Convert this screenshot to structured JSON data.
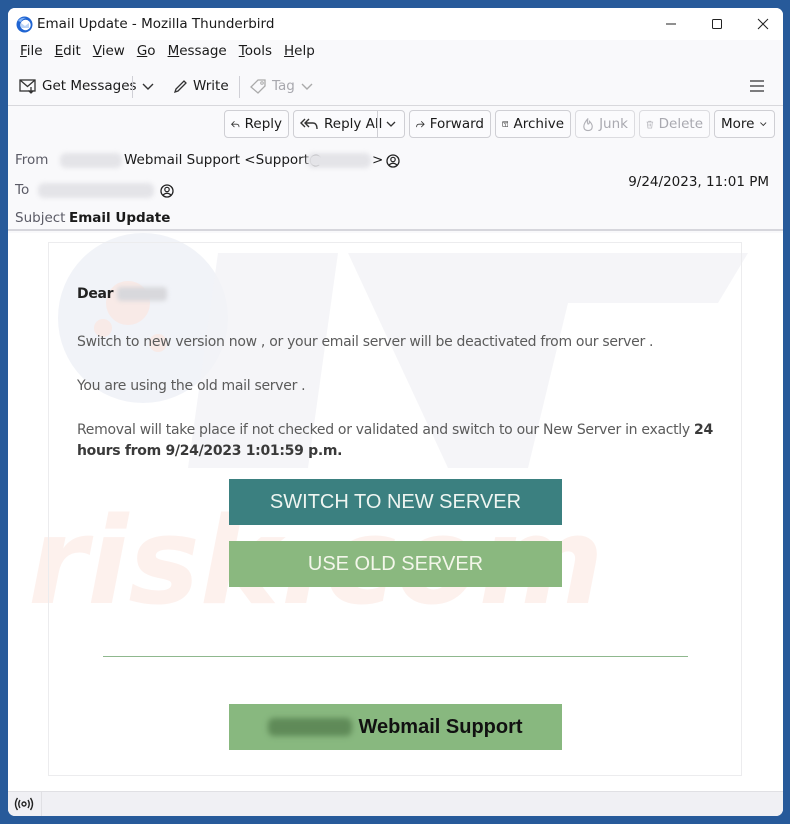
{
  "window": {
    "title": "Email Update - Mozilla Thunderbird",
    "controls": {
      "minimize": "minimize",
      "maximize": "maximize",
      "close": "close"
    }
  },
  "menubar": {
    "items": [
      {
        "label": "File",
        "accel": "F",
        "rest": "ile"
      },
      {
        "label": "Edit",
        "accel": "E",
        "rest": "dit"
      },
      {
        "label": "View",
        "accel": "V",
        "rest": "iew"
      },
      {
        "label": "Go",
        "accel": "G",
        "rest": "o"
      },
      {
        "label": "Message",
        "accel": "M",
        "rest": "essage"
      },
      {
        "label": "Tools",
        "accel": "T",
        "rest": "ools"
      },
      {
        "label": "Help",
        "accel": "H",
        "rest": "elp"
      }
    ]
  },
  "toolbar": {
    "get_messages": "Get Messages",
    "write": "Write",
    "tag": "Tag"
  },
  "header_actions": {
    "reply": "Reply",
    "reply_all": "Reply All",
    "forward": "Forward",
    "archive": "Archive",
    "junk": "Junk",
    "delete": "Delete",
    "more": "More"
  },
  "message_header": {
    "from_label": "From",
    "from_name": "Webmail Support <Support@",
    "from_suffix": ">",
    "to_label": "To",
    "subject_label": "Subject",
    "subject": "Email Update",
    "date": "9/24/2023, 11:01 PM"
  },
  "email_body": {
    "greeting": "Dear",
    "paragraph1": "Switch to new version now  , or your email server will be deactivated from our server .",
    "paragraph2": "You  are using the old  mail server .",
    "paragraph3_text": "Removal will take place if not checked or validated and switch to our New Server in exactly ",
    "paragraph3_bold": "24 hours from 9/24/2023 1:01:59 p.m.",
    "button_new": "SWITCH TO NEW SERVER",
    "button_old": "USE OLD SERVER",
    "signature": "Webmail Support"
  },
  "colors": {
    "window_border": "#275a9a",
    "button_new_bg": "#3b8080",
    "button_old_bg": "#8ab87f",
    "signature_bg": "#88b87f"
  }
}
